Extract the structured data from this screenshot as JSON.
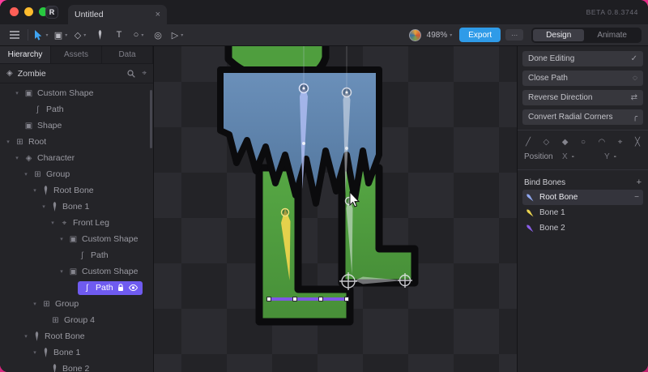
{
  "glyphs": {
    "caret_down": "▾",
    "caret_right": "▸",
    "close": "×",
    "check": "✓",
    "reverse": "⇄",
    "dashed_circle": "◌",
    "corner": "╭",
    "plus": "+",
    "minus": "−",
    "target": "⌖",
    "diamond": "◈",
    "shape": "▣",
    "group": "⊞",
    "path": "ʃ",
    "circle": "○",
    "play": "▷",
    "paint": "◎",
    "text_tool": "T",
    "ellipsis": "⋯",
    "slash": "╱",
    "diamond_open": "◇",
    "diamond_filled": "◆",
    "arc": "◠",
    "cross": "╳"
  },
  "titlebar": {
    "tab_title": "Untitled",
    "beta_label": "BETA 0.8.3744",
    "logo": "R"
  },
  "toolbar": {
    "zoom_value": "498%",
    "export_label": "Export",
    "design_label": "Design",
    "animate_label": "Animate"
  },
  "sidebar": {
    "tabs": [
      {
        "label": "Hierarchy"
      },
      {
        "label": "Assets"
      },
      {
        "label": "Data"
      }
    ],
    "artboard_label": "Zombie",
    "tree": [
      {
        "label": "Custom Shape"
      },
      {
        "label": "Path"
      },
      {
        "label": "Shape"
      },
      {
        "label": "Root"
      },
      {
        "label": "Character"
      },
      {
        "label": "Group"
      },
      {
        "label": "Root Bone"
      },
      {
        "label": "Bone 1"
      },
      {
        "label": "Front Leg"
      },
      {
        "label": "Custom Shape"
      },
      {
        "label": "Path"
      },
      {
        "label": "Custom Shape"
      },
      {
        "label": "Path"
      },
      {
        "label": "Group"
      },
      {
        "label": "Group 4"
      },
      {
        "label": "Root Bone"
      },
      {
        "label": "Bone 1"
      },
      {
        "label": "Bone 2"
      }
    ]
  },
  "inspector": {
    "actions": [
      {
        "label": "Done Editing"
      },
      {
        "label": "Close Path"
      },
      {
        "label": "Reverse Direction"
      },
      {
        "label": "Convert Radial Corners"
      }
    ],
    "position_label": "Position",
    "x_label": "X",
    "x_value": "-",
    "y_label": "Y",
    "y_value": "-",
    "bind_bones_title": "Bind Bones",
    "bind_bones": [
      {
        "label": "Root Bone",
        "color": "#8fa7f0"
      },
      {
        "label": "Bone 1",
        "color": "#e8d24f"
      },
      {
        "label": "Bone 2",
        "color": "#8a5fe8"
      }
    ]
  },
  "colors": {
    "accent_blue": "#2f9be8",
    "selection_purple": "#6f5bf0",
    "zombie_green": "#4f9e3e",
    "pants_blue": "#5b82ab"
  }
}
